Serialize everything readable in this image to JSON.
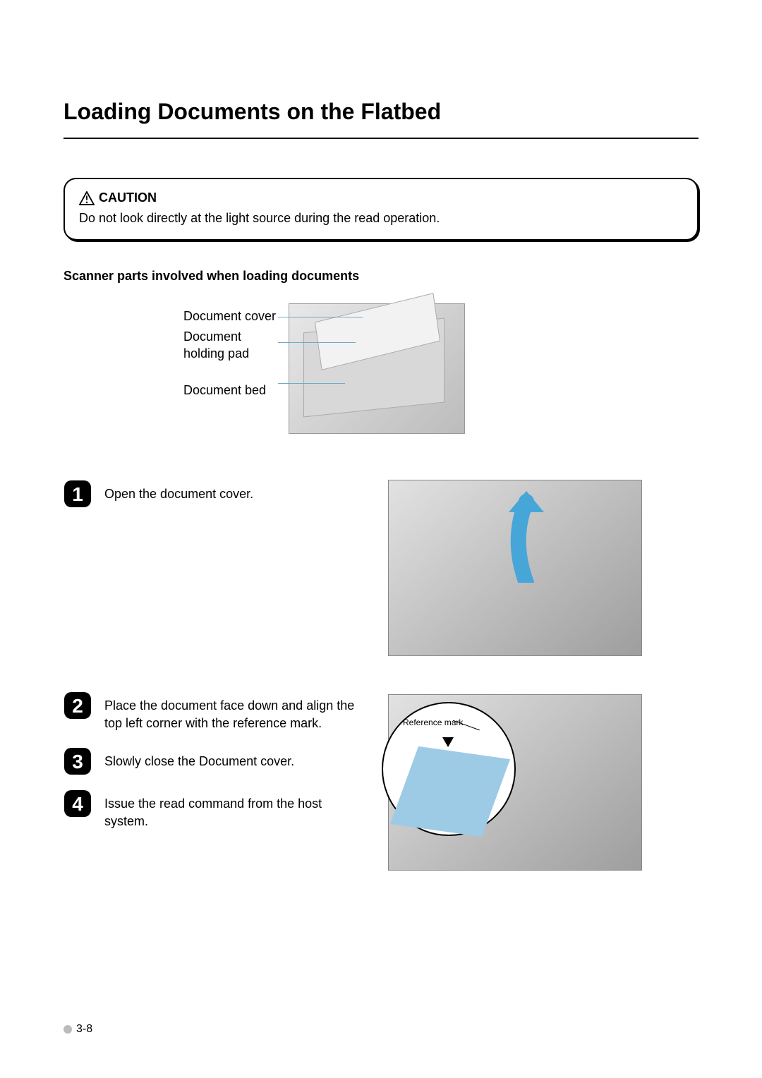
{
  "title": "Loading Documents on the Flatbed",
  "caution": {
    "heading": "CAUTION",
    "text": "Do not look directly at the light source during the read operation."
  },
  "section_heading": "Scanner parts involved when loading documents",
  "diagram_labels": {
    "doc_cover": "Document cover",
    "doc_pad_1": "Document",
    "doc_pad_2": "holding pad",
    "doc_bed": "Document bed"
  },
  "steps": [
    {
      "n": "1",
      "text": "Open the document cover."
    },
    {
      "n": "2",
      "text": "Place the document face down and align the top left corner with the reference mark."
    },
    {
      "n": "3",
      "text": "Slowly close the Document cover."
    },
    {
      "n": "4",
      "text": "Issue the read command from the host system."
    }
  ],
  "reference_label": "Reference mark",
  "page_number": "3-8"
}
